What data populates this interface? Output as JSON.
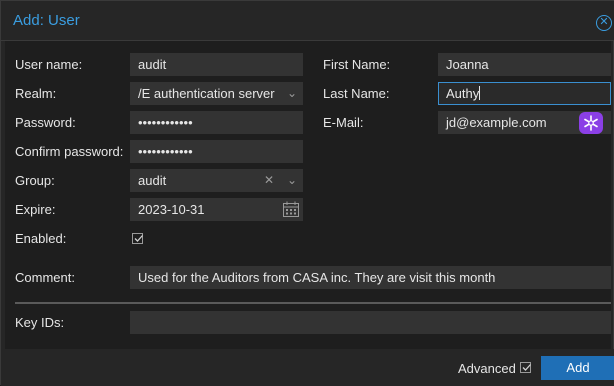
{
  "dialog": {
    "title": "Add: User",
    "accent_color": "#3a9de0"
  },
  "form": {
    "username": {
      "label": "User name:",
      "value": "audit"
    },
    "realm": {
      "label": "Realm:",
      "value": "/E authentication server"
    },
    "password": {
      "label": "Password:",
      "value": "••••••••••••"
    },
    "confirm_password": {
      "label": "Confirm password:",
      "value": "••••••••••••"
    },
    "group": {
      "label": "Group:",
      "value": "audit"
    },
    "expire": {
      "label": "Expire:",
      "value": "2023-10-31"
    },
    "enabled": {
      "label": "Enabled:",
      "checked": true
    },
    "first_name": {
      "label": "First Name:",
      "value": "Joanna"
    },
    "last_name": {
      "label": "Last Name:",
      "value": "Authy"
    },
    "email": {
      "label": "E-Mail:",
      "value": "jd@example.com"
    },
    "comment": {
      "label": "Comment:",
      "value": "Used for the Auditors from CASA inc. They are visit this month"
    },
    "key_ids": {
      "label": "Key IDs:",
      "value": ""
    }
  },
  "footer": {
    "advanced_label": "Advanced",
    "advanced_checked": true,
    "add_label": "Add",
    "button_color": "#1f6fb6"
  },
  "icons": {
    "close": "close-icon",
    "dropdown": "chevron-down-icon",
    "clear": "clear-icon",
    "calendar": "calendar-icon",
    "check": "checkmark-icon",
    "authy": "authy-icon"
  }
}
